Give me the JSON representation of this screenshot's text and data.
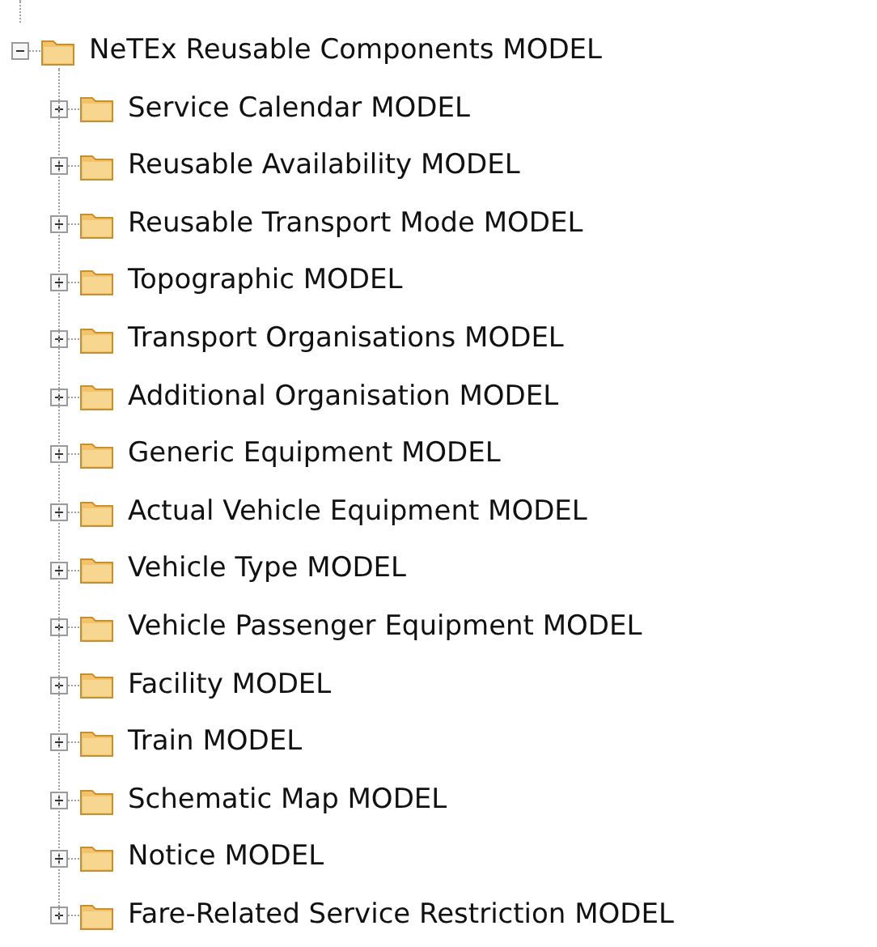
{
  "tree": {
    "label": "NeTEx Reusable Components MODEL",
    "expanded": true,
    "children": [
      {
        "label": "Service Calendar MODEL",
        "expanded": false
      },
      {
        "label": "Reusable Availability MODEL",
        "expanded": false
      },
      {
        "label": "Reusable Transport Mode MODEL",
        "expanded": false
      },
      {
        "label": "Topographic MODEL",
        "expanded": false
      },
      {
        "label": "Transport Organisations MODEL",
        "expanded": false
      },
      {
        "label": "Additional Organisation MODEL",
        "expanded": false
      },
      {
        "label": "Generic Equipment MODEL",
        "expanded": false
      },
      {
        "label": "Actual Vehicle Equipment MODEL",
        "expanded": false
      },
      {
        "label": "Vehicle Type MODEL",
        "expanded": false
      },
      {
        "label": "Vehicle Passenger Equipment MODEL",
        "expanded": false
      },
      {
        "label": "Facility MODEL",
        "expanded": false
      },
      {
        "label": "Train MODEL",
        "expanded": false
      },
      {
        "label": "Schematic Map MODEL",
        "expanded": false
      },
      {
        "label": "Notice MODEL",
        "expanded": false
      },
      {
        "label": "Fare-Related Service Restriction MODEL",
        "expanded": false
      }
    ]
  }
}
